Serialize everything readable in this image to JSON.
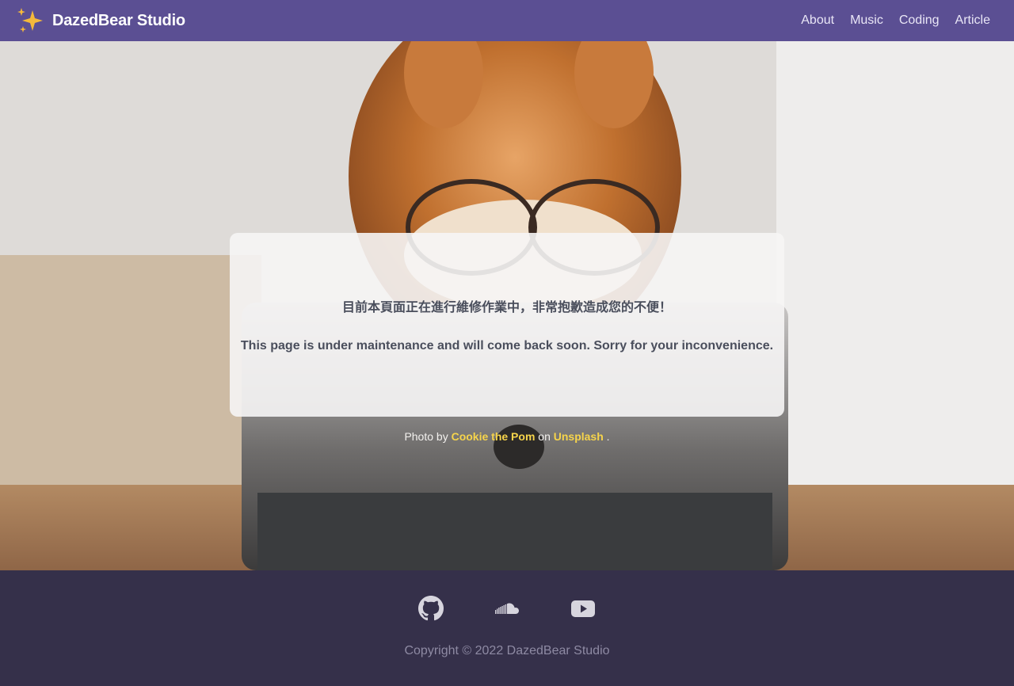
{
  "brand": {
    "name": "DazedBear Studio",
    "icon": "sparkles-icon",
    "accent": "#f5b93b"
  },
  "nav": {
    "items": [
      {
        "label": "About"
      },
      {
        "label": "Music"
      },
      {
        "label": "Coding"
      },
      {
        "label": "Article"
      }
    ],
    "background": "#5b4f93"
  },
  "notice": {
    "message_zh": "目前本頁面正在進行維修作業中，非常抱歉造成您的不便！",
    "message_en": "This page is under maintenance and will come back soon. Sorry for your inconvenience."
  },
  "credit": {
    "prefix": "Photo by",
    "author": "Cookie the Pom",
    "middle": "on",
    "site": "Unsplash",
    "suffix": ".",
    "link_color": "#f6d44b"
  },
  "footer": {
    "social": [
      {
        "name": "GitHub",
        "icon": "github-icon"
      },
      {
        "name": "SoundCloud",
        "icon": "soundcloud-icon"
      },
      {
        "name": "YouTube",
        "icon": "youtube-icon"
      }
    ],
    "copyright": "Copyright © 2022 DazedBear Studio",
    "background": "#35304a"
  }
}
